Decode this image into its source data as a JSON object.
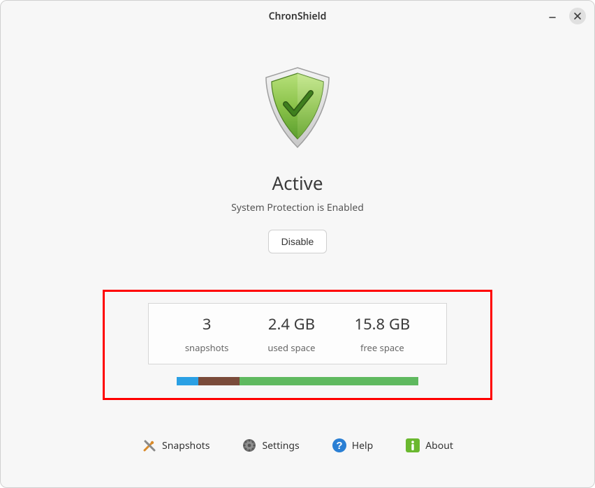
{
  "window": {
    "title": "ChronShield"
  },
  "status": {
    "title": "Active",
    "subtitle": "System Protection is Enabled",
    "disable_button": "Disable"
  },
  "stats": {
    "snapshots": {
      "value": "3",
      "label": "snapshots"
    },
    "used": {
      "value": "2.4 GB",
      "label": "used space"
    },
    "free": {
      "value": "15.8 GB",
      "label": "free space"
    }
  },
  "disk_bar": {
    "segments": [
      {
        "color": "blue",
        "percent": 9
      },
      {
        "color": "brown",
        "percent": 17
      },
      {
        "color": "green",
        "percent": 74
      }
    ]
  },
  "nav": {
    "snapshots": "Snapshots",
    "settings": "Settings",
    "help": "Help",
    "about": "About"
  }
}
